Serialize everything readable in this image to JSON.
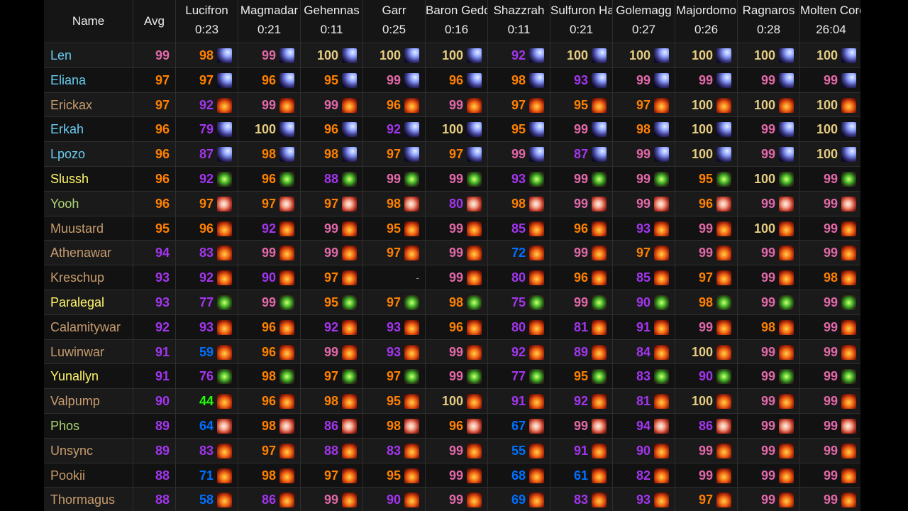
{
  "header": {
    "name_label": "Name",
    "avg_label": "Avg",
    "bosses": [
      {
        "name": "Lucifron",
        "time": "0:23"
      },
      {
        "name": "Magmadar",
        "time": "0:21"
      },
      {
        "name": "Gehennas",
        "time": "0:11"
      },
      {
        "name": "Garr",
        "time": "0:25"
      },
      {
        "name": "Baron Geddon",
        "time": "0:16"
      },
      {
        "name": "Shazzrah",
        "time": "0:11"
      },
      {
        "name": "Sulfuron Harbinger",
        "time": "0:21"
      },
      {
        "name": "Golemagg",
        "time": "0:27"
      },
      {
        "name": "Majordomo",
        "time": "0:26"
      },
      {
        "name": "Ragnaros",
        "time": "0:28"
      },
      {
        "name": "Molten Core",
        "time": "26:04"
      }
    ]
  },
  "colors": {
    "legendary": "#ff8000",
    "epic": "#a335ee",
    "rare": "#0070ff",
    "uncommon": "#1eff00",
    "astounding": "#e268a8",
    "perfect": "#e5cc80",
    "mage": "#69ccf0",
    "warrior": "#c79c6e",
    "rogue": "#fff569",
    "hunter": "#abd473"
  },
  "players": [
    {
      "name": "Len",
      "cls": "mage",
      "avg": 99,
      "icon": "frost-bolt-icon",
      "scores": [
        98,
        99,
        100,
        100,
        100,
        92,
        100,
        100,
        100,
        100,
        100
      ]
    },
    {
      "name": "Eliana",
      "cls": "mage",
      "avg": 97,
      "icon": "frost-bolt-icon",
      "scores": [
        97,
        96,
        95,
        99,
        96,
        98,
        93,
        99,
        99,
        99,
        99
      ]
    },
    {
      "name": "Erickax",
      "cls": "warrior",
      "avg": 97,
      "icon": "fury-icon",
      "scores": [
        92,
        99,
        99,
        96,
        99,
        97,
        95,
        97,
        100,
        100,
        100
      ]
    },
    {
      "name": "Erkah",
      "cls": "mage",
      "avg": 96,
      "icon": "frost-bolt-icon",
      "scores": [
        79,
        100,
        96,
        92,
        100,
        95,
        99,
        98,
        100,
        99,
        100
      ]
    },
    {
      "name": "Lpozo",
      "cls": "mage",
      "avg": 96,
      "icon": "frost-bolt-icon",
      "scores": [
        87,
        98,
        98,
        97,
        97,
        99,
        87,
        99,
        100,
        99,
        100
      ]
    },
    {
      "name": "Slussh",
      "cls": "rogue",
      "avg": 96,
      "icon": "combat-swords-icon",
      "scores": [
        92,
        96,
        88,
        99,
        99,
        93,
        99,
        99,
        95,
        100,
        99
      ]
    },
    {
      "name": "Yooh",
      "cls": "hunter",
      "avg": 96,
      "icon": "marksmanship-icon",
      "scores": [
        97,
        97,
        97,
        98,
        80,
        98,
        99,
        99,
        96,
        99,
        99
      ]
    },
    {
      "name": "Muustard",
      "cls": "warrior",
      "avg": 95,
      "icon": "fury-icon",
      "scores": [
        96,
        92,
        99,
        95,
        99,
        85,
        96,
        93,
        99,
        100,
        99
      ]
    },
    {
      "name": "Athenawar",
      "cls": "warrior",
      "avg": 94,
      "icon": "fury-icon",
      "scores": [
        83,
        99,
        99,
        97,
        99,
        72,
        99,
        97,
        99,
        99,
        99
      ]
    },
    {
      "name": "Kreschup",
      "cls": "warrior",
      "avg": 93,
      "icon": "fury-icon",
      "scores": [
        92,
        90,
        97,
        null,
        99,
        80,
        96,
        85,
        97,
        99,
        98
      ]
    },
    {
      "name": "Paralegal",
      "cls": "rogue",
      "avg": 93,
      "icon": "combat-swords-icon",
      "scores": [
        77,
        99,
        95,
        97,
        98,
        75,
        99,
        90,
        98,
        99,
        99
      ]
    },
    {
      "name": "Calamitywar",
      "cls": "warrior",
      "avg": 92,
      "icon": "fury-icon",
      "scores": [
        93,
        96,
        92,
        93,
        96,
        80,
        81,
        91,
        99,
        98,
        99
      ]
    },
    {
      "name": "Luwinwar",
      "cls": "warrior",
      "avg": 91,
      "icon": "fury-icon",
      "scores": [
        59,
        96,
        99,
        93,
        99,
        92,
        89,
        84,
        100,
        99,
        99
      ]
    },
    {
      "name": "Yunallyn",
      "cls": "rogue",
      "avg": 91,
      "icon": "combat-swords-icon",
      "scores": [
        76,
        98,
        97,
        97,
        99,
        77,
        95,
        83,
        90,
        99,
        99
      ]
    },
    {
      "name": "Valpump",
      "cls": "warrior",
      "avg": 90,
      "icon": "fury-icon",
      "scores": [
        44,
        96,
        98,
        95,
        100,
        91,
        92,
        81,
        100,
        99,
        99
      ]
    },
    {
      "name": "Phos",
      "cls": "hunter",
      "avg": 89,
      "icon": "marksmanship-icon",
      "scores": [
        64,
        98,
        86,
        98,
        96,
        67,
        99,
        94,
        86,
        99,
        99
      ]
    },
    {
      "name": "Unsync",
      "cls": "warrior",
      "avg": 89,
      "icon": "fury-icon",
      "scores": [
        83,
        97,
        88,
        83,
        99,
        55,
        91,
        90,
        99,
        99,
        99
      ]
    },
    {
      "name": "Pookii",
      "cls": "warrior",
      "avg": 88,
      "icon": "fury-icon",
      "scores": [
        71,
        98,
        97,
        95,
        99,
        68,
        61,
        82,
        99,
        99,
        99
      ]
    },
    {
      "name": "Thormagus",
      "cls": "warrior",
      "avg": 88,
      "icon": "fury-icon",
      "scores": [
        58,
        86,
        99,
        90,
        99,
        69,
        83,
        93,
        97,
        99,
        99
      ]
    }
  ]
}
